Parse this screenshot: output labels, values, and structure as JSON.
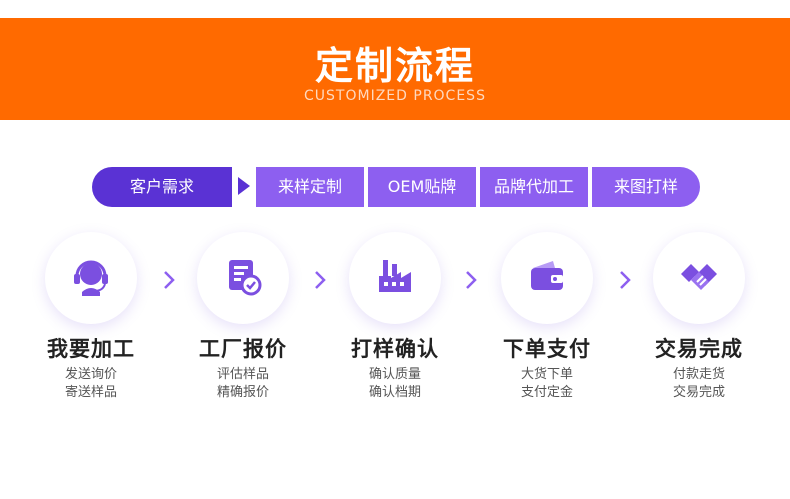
{
  "header": {
    "title": "定制流程",
    "subtitle": "CUSTOMIZED PROCESS"
  },
  "tabs": [
    {
      "label": "客户需求"
    },
    {
      "label": "来样定制"
    },
    {
      "label": "OEM贴牌"
    },
    {
      "label": "品牌代加工"
    },
    {
      "label": "来图打样"
    }
  ],
  "steps": [
    {
      "title": "我要加工",
      "line1": "发送询价",
      "line2": "寄送样品",
      "icon": "customer-service-icon"
    },
    {
      "title": "工厂报价",
      "line1": "评估样品",
      "line2": "精确报价",
      "icon": "document-quote-icon"
    },
    {
      "title": "打样确认",
      "line1": "确认质量",
      "line2": "确认档期",
      "icon": "factory-icon"
    },
    {
      "title": "下单支付",
      "line1": "大货下单",
      "line2": "支付定金",
      "icon": "wallet-icon"
    },
    {
      "title": "交易完成",
      "line1": "付款走货",
      "line2": "交易完成",
      "icon": "handshake-icon"
    }
  ],
  "colors": {
    "header_bg": "#ff6a00",
    "tab_active": "#5a32d4",
    "tab": "#8d5ff0",
    "icon": "#7b4fe0"
  }
}
